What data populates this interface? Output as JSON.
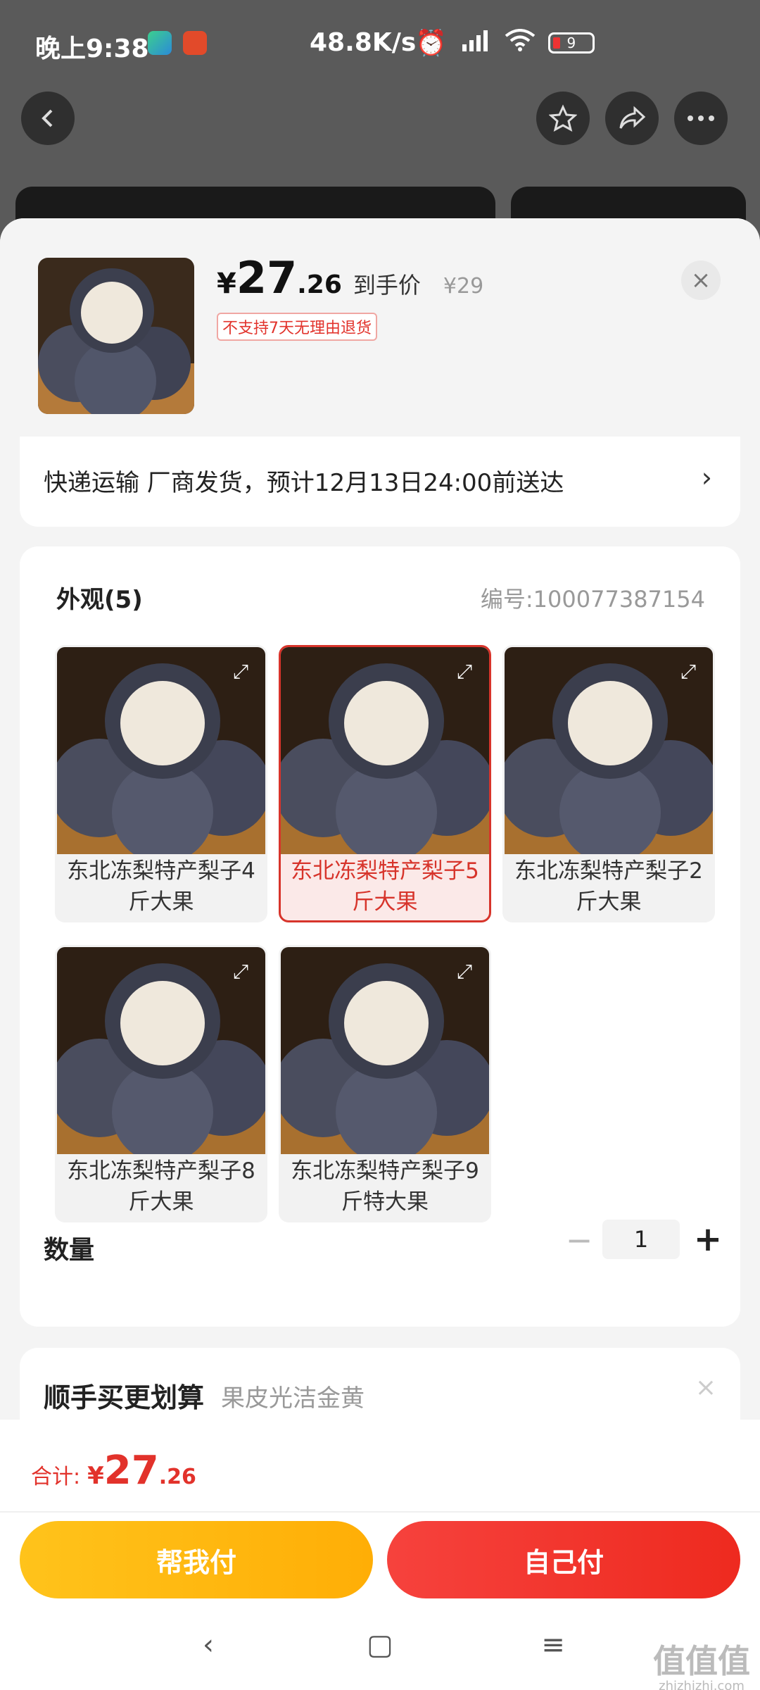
{
  "status_bar": {
    "time": "晚上9:38",
    "speed": "48.8K/s",
    "battery": "9",
    "icons": [
      "alarm-icon",
      "signal-icon",
      "wifi-icon",
      "battery-icon"
    ]
  },
  "background_header": {
    "icons": [
      "back-icon",
      "favorite-star-icon",
      "share-icon",
      "more-icon"
    ]
  },
  "sheet": {
    "price": {
      "currency": "¥",
      "integer": "27",
      "decimal": ".26",
      "label": "到手价",
      "original": "¥29"
    },
    "return_badge": "不支持7天无理由退货",
    "close_icon": "×",
    "delivery": {
      "text": "快递运输 厂商发货，预计12月13日24:00前送达",
      "chevron": "›"
    },
    "spec": {
      "title": "外观(5)",
      "code": "编号:100077387154",
      "variants": [
        {
          "label": "东北冻梨特产梨子4斤大果",
          "selected": false
        },
        {
          "label": "东北冻梨特产梨子5斤大果",
          "selected": true
        },
        {
          "label": "东北冻梨特产梨子2斤大果",
          "selected": false
        },
        {
          "label": "东北冻梨特产梨子8斤大果",
          "selected": false
        },
        {
          "label": "东北冻梨特产梨子9斤特大果",
          "selected": false
        }
      ],
      "expand_icon": "⤢"
    },
    "quantity": {
      "label": "数量",
      "minus": "−",
      "value": "1",
      "plus": "+"
    },
    "addon": {
      "title": "顺手买更划算",
      "subtitle": "果皮光洁金黄",
      "close": "×"
    },
    "footer": {
      "total_label": "合计:",
      "currency": "¥",
      "integer": "27",
      "decimal": ".26",
      "help_pay": "帮我付",
      "self_pay": "自己付"
    },
    "nav": {
      "back": "‹",
      "home": "▢",
      "menu": "≡"
    },
    "watermark": {
      "main": "值值值",
      "sub": "zhizhizhi.com"
    }
  },
  "colors": {
    "accent_red": "#e2322b",
    "help_yellow": "#ffb90f",
    "self_red": "#f3372c"
  }
}
